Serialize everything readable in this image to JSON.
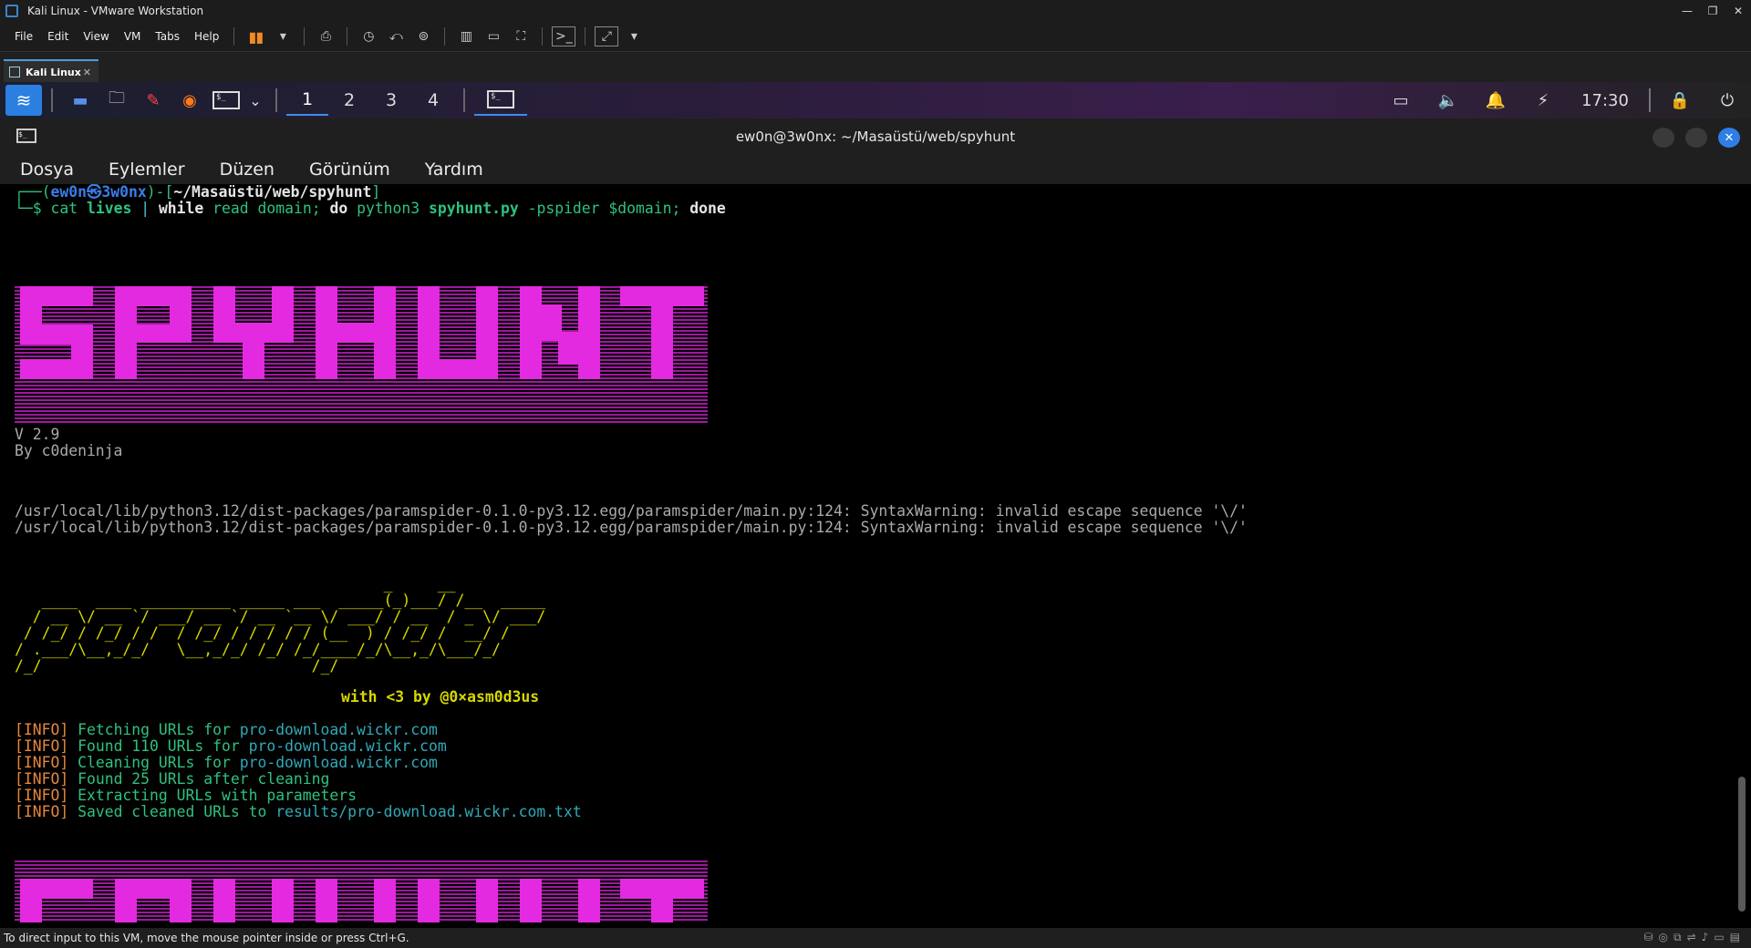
{
  "vmware": {
    "window_title": "Kali Linux - VMware Workstation",
    "menu": [
      "File",
      "Edit",
      "View",
      "VM",
      "Tabs",
      "Help"
    ],
    "tab_label": "Kali Linux",
    "status_text": "To direct input to this VM, move the mouse pointer inside or press Ctrl+G."
  },
  "panel": {
    "workspaces": [
      "1",
      "2",
      "3",
      "4"
    ],
    "clock": "17:30"
  },
  "terminal": {
    "title": "ew0n@3w0nx: ~/Masaüstü/web/spyhunt",
    "menu": [
      "Dosya",
      "Eylemler",
      "Düzen",
      "Görünüm",
      "Yardım"
    ],
    "prompt": {
      "open": "┌──(",
      "user": "ew0n㉿3w0nx",
      "mid": ")-[",
      "path": "~/Masaüstü/web/spyhunt",
      "close": "]",
      "dollar": "└─$",
      "cmd_cat": "cat",
      "cmd_lives": "lives",
      "cmd_pipe": "|",
      "cmd_while": "while",
      "cmd_read": "read domain;",
      "cmd_do": "do",
      "cmd_python": "python3",
      "cmd_script": "spyhunt.py",
      "cmd_flag": "-pspider",
      "cmd_var": "$domain;",
      "cmd_done": "done"
    },
    "version": "V 2.9",
    "author": "By c0deninja",
    "warnings": [
      "/usr/local/lib/python3.12/dist-packages/paramspider-0.1.0-py3.12.egg/paramspider/main.py:124: SyntaxWarning: invalid escape sequence '\\/'",
      "/usr/local/lib/python3.12/dist-packages/paramspider-0.1.0-py3.12.egg/paramspider/main.py:124: SyntaxWarning: invalid escape sequence '\\/'"
    ],
    "paramspider_art": [
      "                                         _     __",
      "   ____  ____ __________ _____ ___  _____(_)___/ /__  _____",
      "  / __ \\/ __ `/ ___/ __ `/ __ `__ \\/ ___/ / __  / _ \\/ ___/",
      " / /_/ / /_/ / /  / /_/ / / / / / (__  ) / /_/ /  __/ /",
      "/ .___/\\__,_/_/   \\__,_/_/ /_/ /_/____/_/\\__,_/\\___/_/",
      "/_/                              /_/"
    ],
    "credit": "with <3 by @0×asm0d3us",
    "info_lines": [
      {
        "tag": "[INFO]",
        "msg": "Fetching URLs for ",
        "target": "pro-download.wickr.com"
      },
      {
        "tag": "[INFO]",
        "msg": "Found 110 URLs for ",
        "target": "pro-download.wickr.com"
      },
      {
        "tag": "[INFO]",
        "msg": "Cleaning URLs for ",
        "target": "pro-download.wickr.com"
      },
      {
        "tag": "[INFO]",
        "msg": "Found 25 URLs after cleaning",
        "target": ""
      },
      {
        "tag": "[INFO]",
        "msg": "Extracting URLs with parameters",
        "target": ""
      },
      {
        "tag": "[INFO]",
        "msg": "Saved cleaned URLs to ",
        "target": "results/pro-download.wickr.com.txt"
      }
    ]
  },
  "colors": {
    "banner_pink": "#e42ae0",
    "kali_blue": "#2b7fe0",
    "prompt_green": "#2ec27e",
    "prompt_blue": "#3b7de8"
  }
}
